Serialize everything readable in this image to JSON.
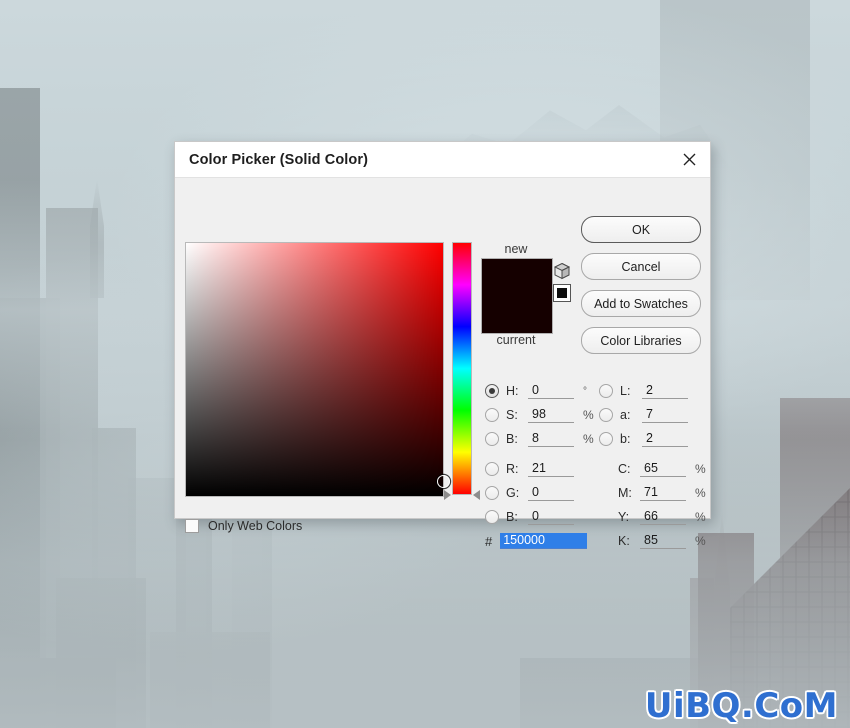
{
  "watermark": {
    "text": "UiBQ.CoM",
    "color": "#2f6fd0"
  },
  "dialog": {
    "title": "Color Picker (Solid Color)",
    "close_icon": "close-icon",
    "buttons": [
      {
        "label": "OK",
        "name": "ok-button"
      },
      {
        "label": "Cancel",
        "name": "cancel-button"
      },
      {
        "label": "Add to Swatches",
        "name": "add-to-swatches-button"
      },
      {
        "label": "Color Libraries",
        "name": "color-libraries-button"
      }
    ],
    "preview": {
      "new_label": "new",
      "current_label": "current",
      "new_color": "#150000",
      "current_color": "#150000",
      "gamut_icon": "cube-out-of-gamut-icon",
      "websafe_icon": "web-safe-color-icon"
    },
    "picker": {
      "hue_color": "#ff0000",
      "cursor_x_pct": 99,
      "cursor_y_pct": 93,
      "hue_marker_pct": 100
    },
    "hsb": [
      {
        "label": "H:",
        "value": "0",
        "unit": "°",
        "selected": true
      },
      {
        "label": "S:",
        "value": "98",
        "unit": "%",
        "selected": false
      },
      {
        "label": "B:",
        "value": "8",
        "unit": "%",
        "selected": false
      }
    ],
    "rgb": [
      {
        "label": "R:",
        "value": "21",
        "unit": "",
        "selected": false
      },
      {
        "label": "G:",
        "value": "0",
        "unit": "",
        "selected": false
      },
      {
        "label": "B:",
        "value": "0",
        "unit": "",
        "selected": false
      }
    ],
    "lab": [
      {
        "label": "L:",
        "value": "2",
        "unit": "",
        "selected": false
      },
      {
        "label": "a:",
        "value": "7",
        "unit": "",
        "selected": false
      },
      {
        "label": "b:",
        "value": "2",
        "unit": "",
        "selected": false
      }
    ],
    "cmyk": [
      {
        "label": "C:",
        "value": "65",
        "unit": "%"
      },
      {
        "label": "M:",
        "value": "71",
        "unit": "%"
      },
      {
        "label": "Y:",
        "value": "66",
        "unit": "%"
      },
      {
        "label": "K:",
        "value": "85",
        "unit": "%"
      }
    ],
    "hex": {
      "symbol": "#",
      "value": "150000",
      "selected": true
    },
    "only_web_colors": {
      "label": "Only Web Colors",
      "checked": false
    }
  }
}
